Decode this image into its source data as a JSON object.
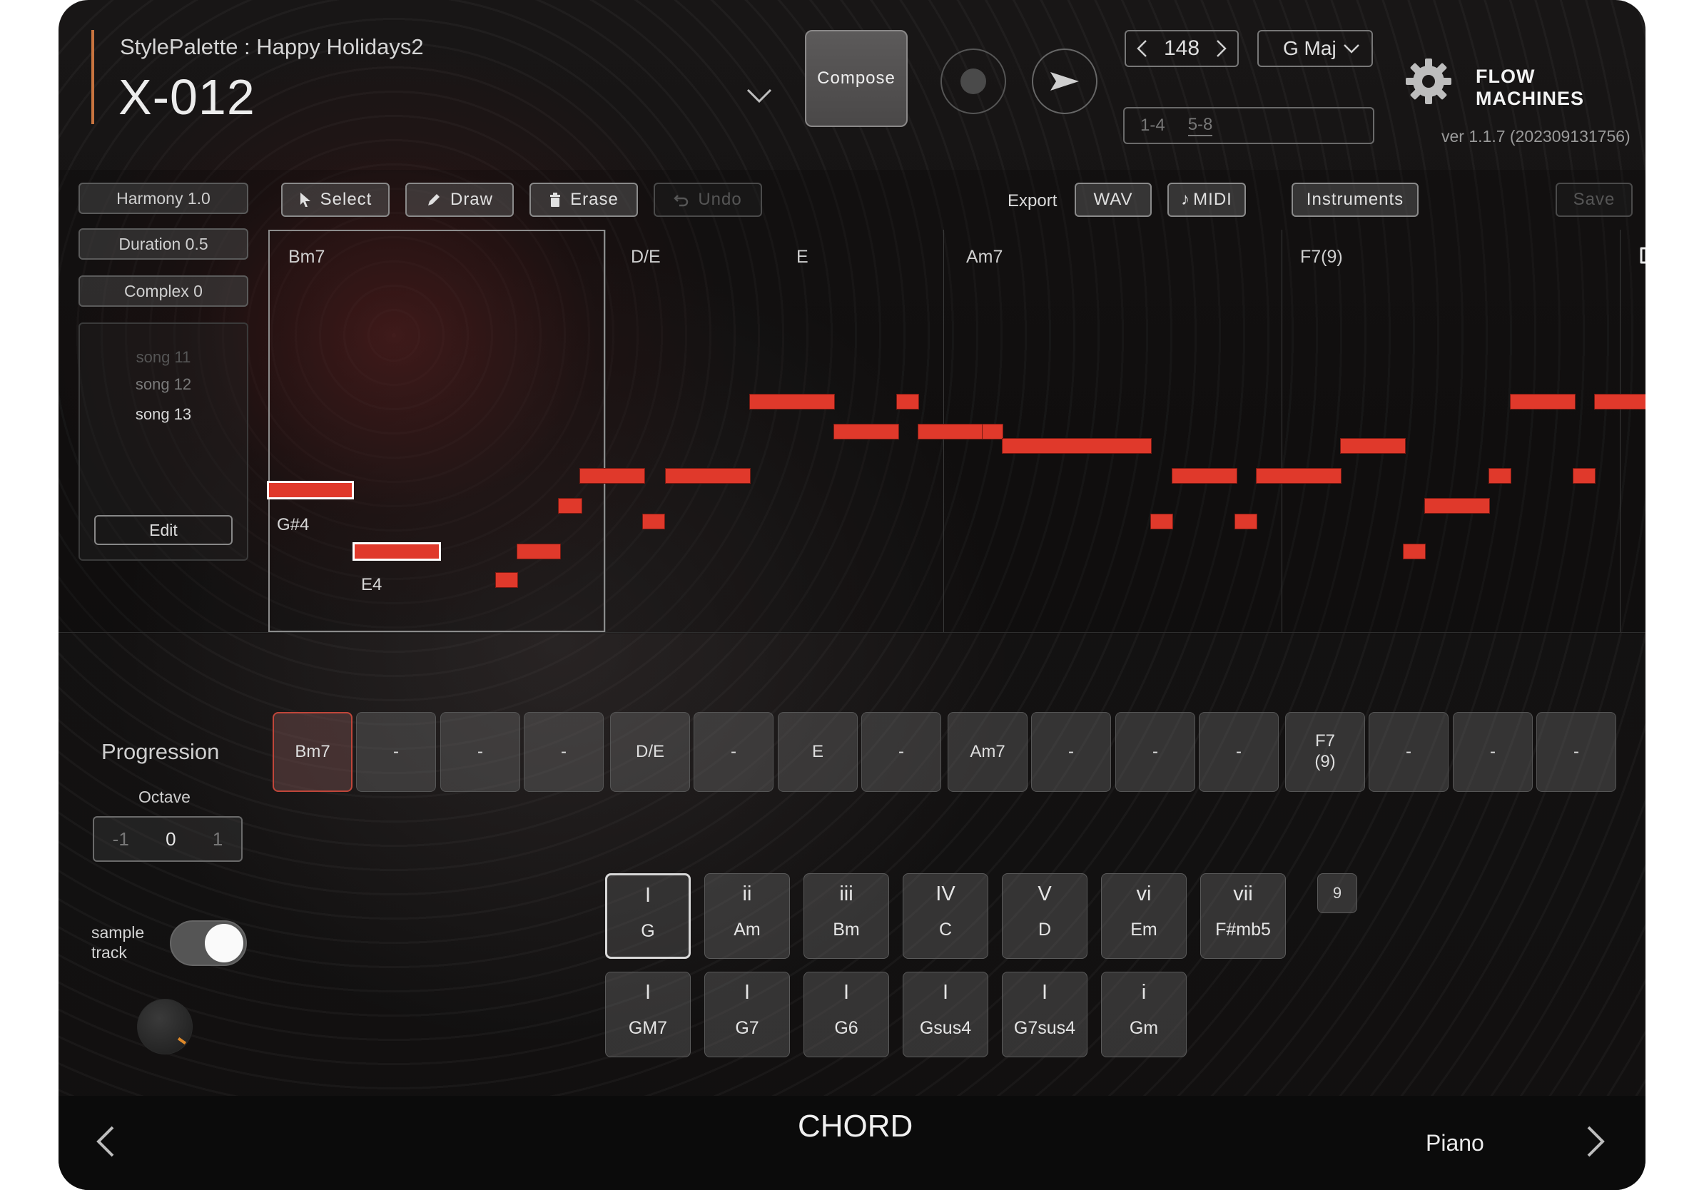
{
  "header": {
    "style_palette": "StylePalette : Happy Holidays2",
    "song_title": "X-012",
    "compose_label": "Compose",
    "tempo": "148",
    "key": "G Maj",
    "bar_ranges": [
      "1-4",
      "5-8"
    ],
    "version": "ver 1.1.7 (202309131756)",
    "logo": "FLOW MACHINES"
  },
  "params": {
    "harmony": "Harmony 1.0",
    "duration": "Duration 0.5",
    "complex": "Complex 0"
  },
  "songs": {
    "items": [
      "song 11",
      "song 12",
      "song 13"
    ],
    "edit_label": "Edit"
  },
  "toolbar": {
    "select": "Select",
    "draw": "Draw",
    "erase": "Erase",
    "undo": "Undo",
    "export": "Export",
    "wav": "WAV",
    "midi": "MIDI",
    "instruments": "Instruments",
    "save": "Save"
  },
  "roll": {
    "chords": [
      "Bm7",
      "D/E",
      "E",
      "Am7",
      "F7(9)"
    ],
    "note_labels": [
      "G#4",
      "E4"
    ]
  },
  "progression": {
    "title": "Progression",
    "octave_title": "Octave",
    "octave_values": [
      "-1",
      "0",
      "1"
    ],
    "slots": [
      "Bm7",
      "-",
      "-",
      "-",
      "D/E",
      "-",
      "E",
      "-",
      "Am7",
      "-",
      "-",
      "-",
      "F7\n(9)",
      "-",
      "-",
      "-"
    ]
  },
  "chord_palette": {
    "row1": [
      {
        "degree": "I",
        "name": "G"
      },
      {
        "degree": "ii",
        "name": "Am"
      },
      {
        "degree": "iii",
        "name": "Bm"
      },
      {
        "degree": "IV",
        "name": "C"
      },
      {
        "degree": "V",
        "name": "D"
      },
      {
        "degree": "vi",
        "name": "Em"
      },
      {
        "degree": "vii",
        "name": "F#mb5"
      }
    ],
    "row2": [
      {
        "degree": "I",
        "name": "GM7"
      },
      {
        "degree": "I",
        "name": "G7"
      },
      {
        "degree": "I",
        "name": "G6"
      },
      {
        "degree": "I",
        "name": "Gsus4"
      },
      {
        "degree": "I",
        "name": "G7sus4"
      },
      {
        "degree": "i",
        "name": "Gm"
      }
    ],
    "extension": "9"
  },
  "sample_track": {
    "label_line1": "sample",
    "label_line2": "track",
    "enabled": true
  },
  "footer": {
    "title": "CHORD",
    "instrument": "Piano"
  },
  "colors": {
    "note": "#e0392b",
    "accent": "#c8743f",
    "active_slot": "#c0463a"
  }
}
